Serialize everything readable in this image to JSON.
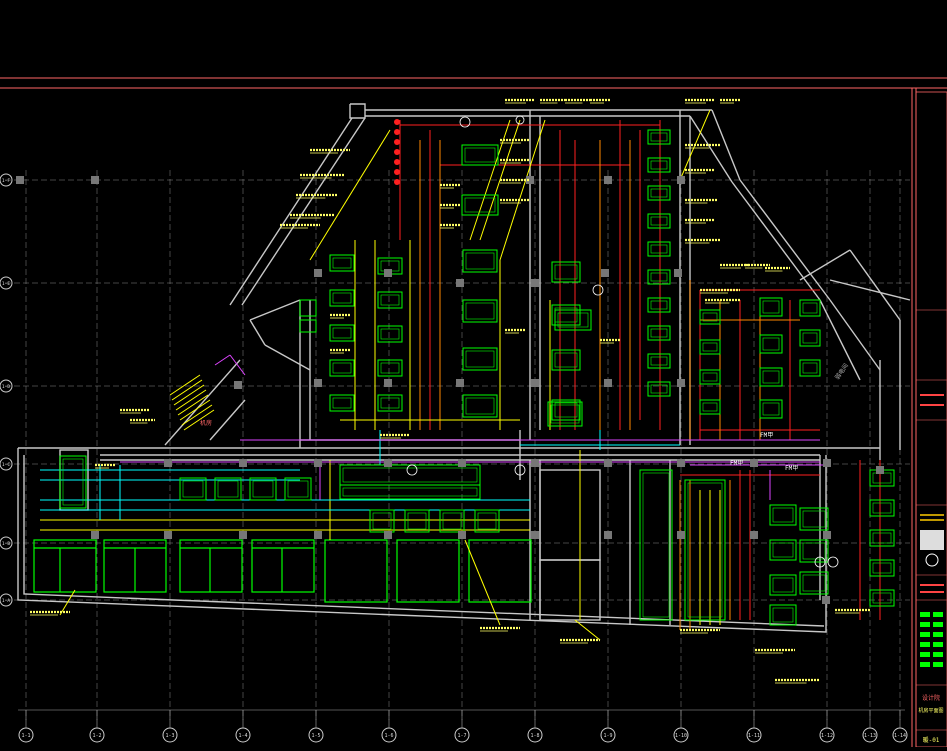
{
  "drawing": {
    "background": "#000000",
    "colors": {
      "border": "#ff6666",
      "wall": "#c8c8c8",
      "equipment": "#00ff00",
      "pipe_hot": "#ff2020",
      "pipe_supply": "#ff8800",
      "pipe_yellow": "#ffff00",
      "pipe_cyan": "#00ffff",
      "pipe_magenta": "#dd44ff",
      "annotation": "#ffff66",
      "grid": "#aaaaaa"
    },
    "grid_labels_bottom": [
      "1-1",
      "1-2",
      "1-3",
      "1-4",
      "1-5",
      "1-6",
      "1-7",
      "1-8",
      "1-9",
      "1-10",
      "1-11",
      "1-12",
      "1-13",
      "1-14"
    ],
    "grid_labels_left": [
      "1-F",
      "1-E",
      "1-D",
      "1-C",
      "1-B",
      "1-A"
    ],
    "room_labels": {
      "fm1": "FM甲",
      "fm2": "FM甲",
      "fm3": "FM甲",
      "room_a": "机房",
      "room_b": "弱电间"
    },
    "title_block": {
      "company": "设计院",
      "drawing_title": "机房平面图",
      "sheet_no": "暖-01"
    }
  }
}
